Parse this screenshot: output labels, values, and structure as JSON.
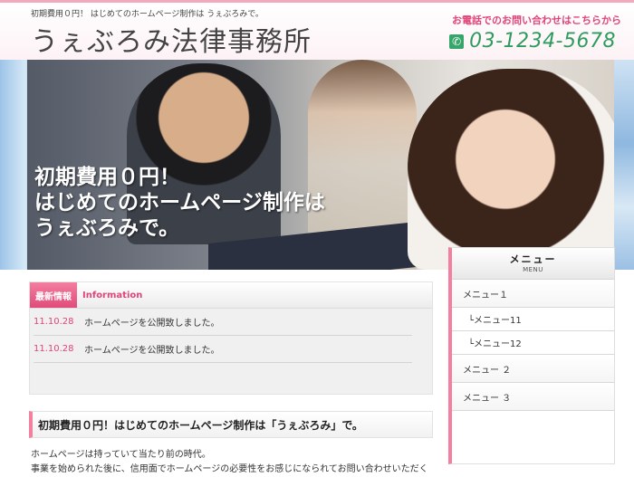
{
  "header": {
    "tagline": "初期費用０円！ はじめてのホームページ制作は うぇぶろみで。",
    "site_title": "うぇぶろみ法律事務所",
    "contact_label": "お電話でのお問い合わせはこちらから",
    "phone_number": "03-1234-5678"
  },
  "hero": {
    "line1": "初期費用０円！",
    "line2": "はじめてのホームページ制作は",
    "line3": "うぇぶろみで。"
  },
  "news": {
    "badge": "最新情報",
    "label_en": "Information",
    "items": [
      {
        "date": "11.10.28",
        "text": "ホームページを公開致しました。"
      },
      {
        "date": "11.10.28",
        "text": "ホームページを公開致しました。"
      }
    ]
  },
  "intro": {
    "heading": "初期費用０円！はじめてのホームページ制作は「うぇぶろみ」で。",
    "line1": "ホームページは持っていて当たり前の時代。",
    "line2": "事業を始められた後に、信用面でホームページの必要性をお感じになられてお問い合わせいただく"
  },
  "menu": {
    "title": "メニュー",
    "subtitle": "MENU",
    "items": [
      {
        "label": "メニュー１"
      },
      {
        "label": "└メニュー11"
      },
      {
        "label": "└メニュー12"
      },
      {
        "label": "メニュー ２"
      },
      {
        "label": "メニュー ３"
      }
    ]
  }
}
